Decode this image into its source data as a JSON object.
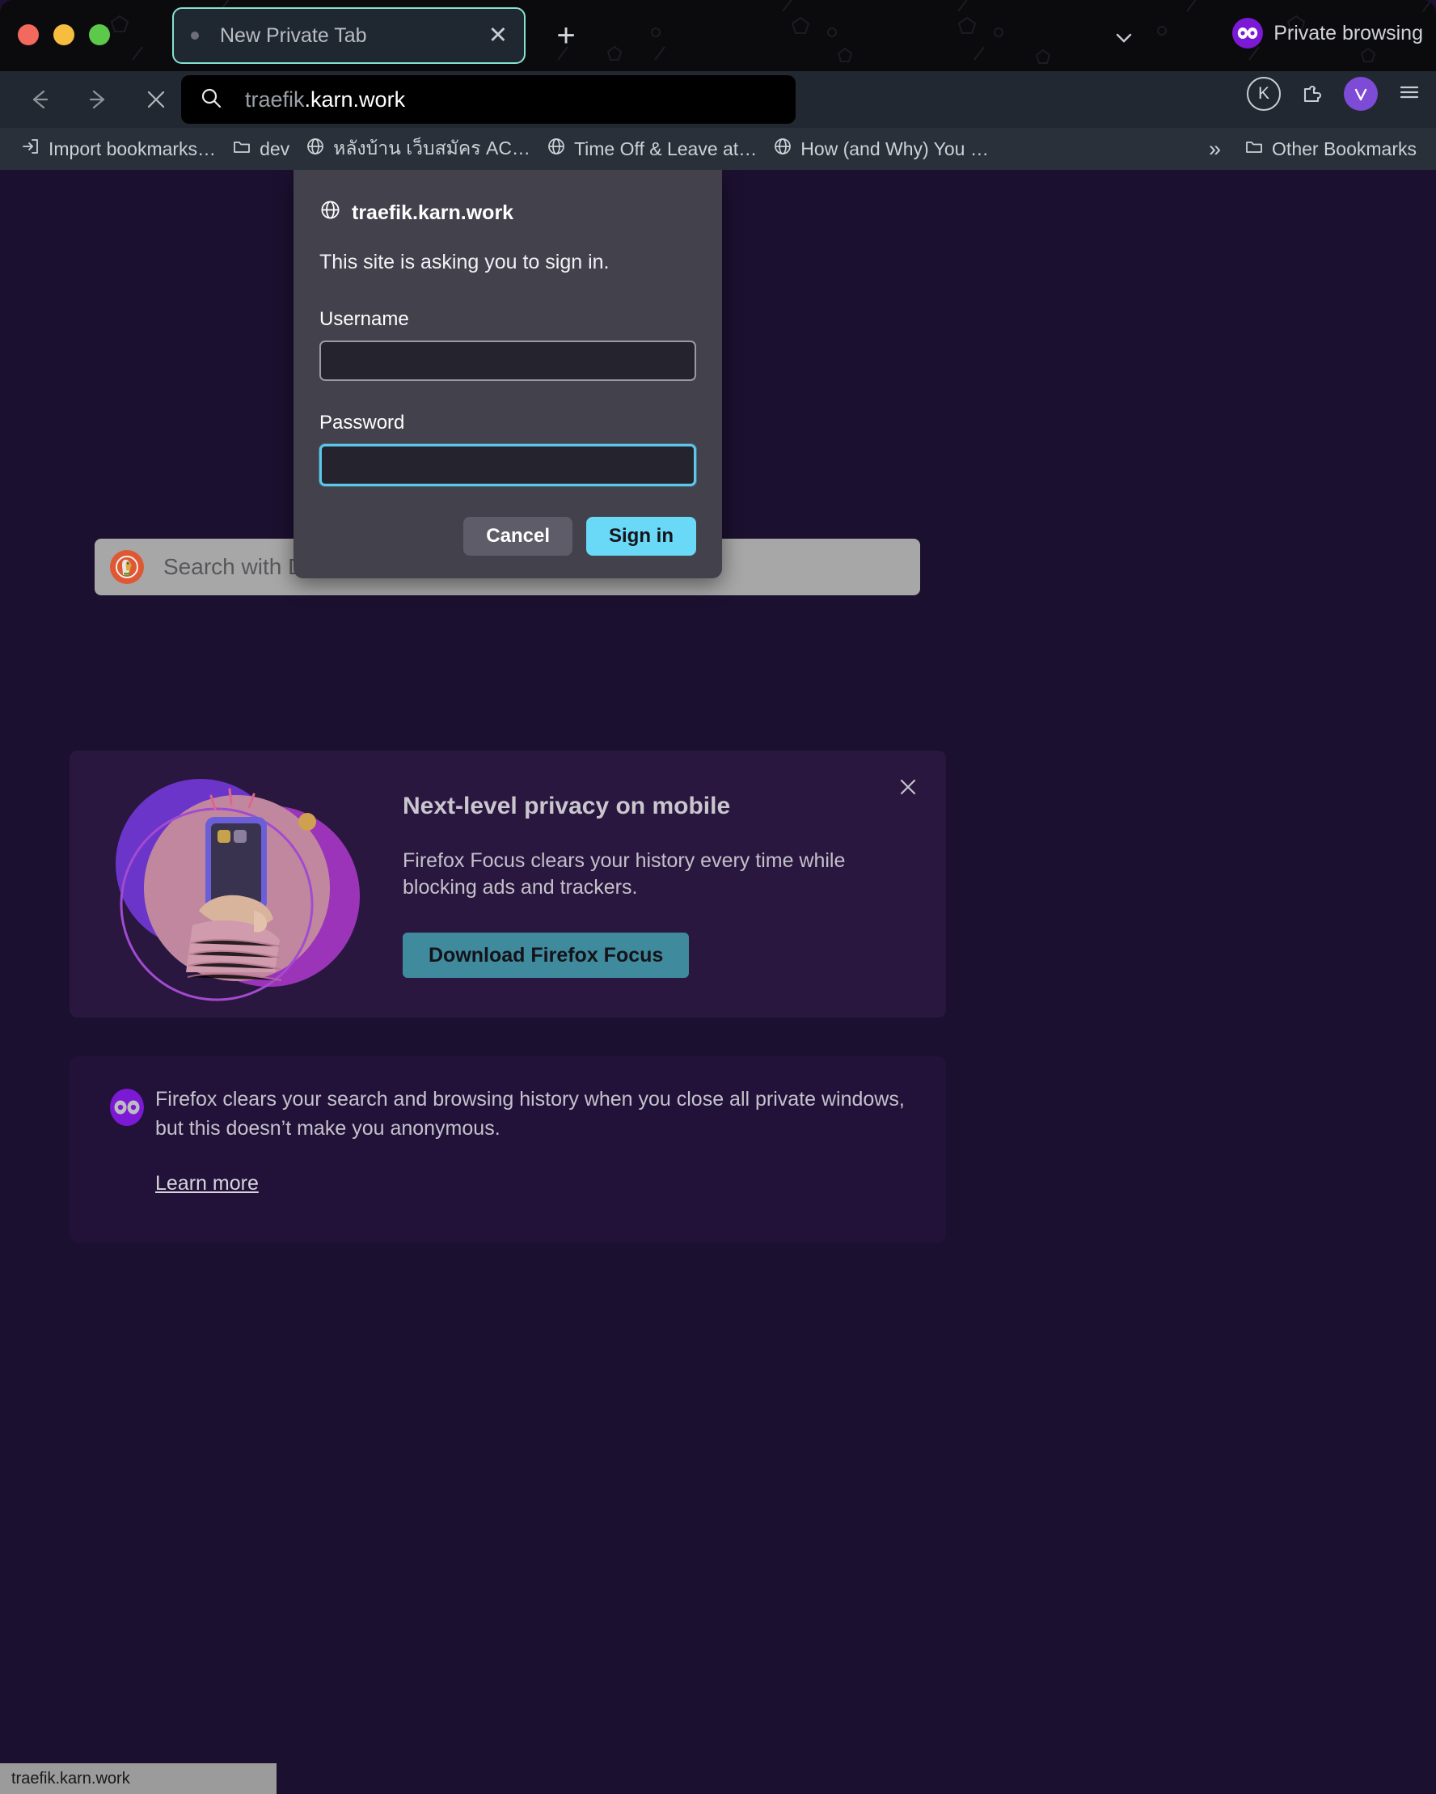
{
  "window": {
    "traffic_lights": [
      "close",
      "minimize",
      "maximize"
    ],
    "colors": {
      "tab_accent": "#86e2d0",
      "private_purple": "#7b19d4",
      "primary_button": "#6ad8f7",
      "focus_border": "#5bc8eb",
      "promo_button": "#3f8a9d",
      "page_background": "#1c1030",
      "dialog_background": "#43414c"
    }
  },
  "tabstrip": {
    "tab": {
      "title": "New Private Tab",
      "close_label": "✕"
    },
    "new_tab_label": "+",
    "tab_list_icon": "chevron-down-icon",
    "private_badge_label": "Private browsing"
  },
  "navbar": {
    "back_icon": "back-arrow-icon",
    "forward_icon": "forward-arrow-icon",
    "stop_icon": "close-icon",
    "urlbar": {
      "search_icon": "search-icon",
      "value_prefix": "traefik",
      "value_domain": ".karn.work",
      "full_value": "traefik.karn.work"
    },
    "account_initial": "K",
    "extensions_icon": "extensions-icon",
    "shield_icon": "shield-check-icon",
    "menu_icon": "hamburger-menu-icon"
  },
  "bookmarks": {
    "items": [
      {
        "label": "Import bookmarks…",
        "icon": "import-icon"
      },
      {
        "label": "dev",
        "icon": "folder-icon"
      },
      {
        "label": "หลังบ้าน เว็บสมัคร AC…",
        "icon": "globe-icon"
      },
      {
        "label": "Time Off & Leave at…",
        "icon": "globe-icon"
      },
      {
        "label": "How (and Why) You …",
        "icon": "globe-icon"
      }
    ],
    "overflow_label": "»",
    "other_bookmarks": {
      "label": "Other Bookmarks",
      "icon": "folder-icon"
    }
  },
  "auth_dialog": {
    "host_icon": "globe-icon",
    "host": "traefik.karn.work",
    "message": "This site is asking you to sign in.",
    "username": {
      "label": "Username",
      "value": "",
      "focused": false
    },
    "password": {
      "label": "Password",
      "value": "",
      "focused": true
    },
    "cancel_label": "Cancel",
    "signin_label": "Sign in"
  },
  "private_page": {
    "search": {
      "engine_icon": "duckduckgo-icon",
      "placeholder": "Search with DuckDuckGo or enter address",
      "value": ""
    },
    "promo": {
      "title": "Next-level privacy on mobile",
      "body": "Firefox Focus clears your history every time while blocking ads and trackers.",
      "button_label": "Download Firefox Focus",
      "close_icon": "close-icon",
      "art": "person-holding-phone-illustration"
    },
    "info": {
      "icon": "private-mask-icon",
      "text": "Firefox clears your search and browsing history when you close all private windows, but this doesn’t make you anonymous.",
      "link_label": "Learn more"
    }
  },
  "statusbar": {
    "text": "traefik.karn.work"
  }
}
